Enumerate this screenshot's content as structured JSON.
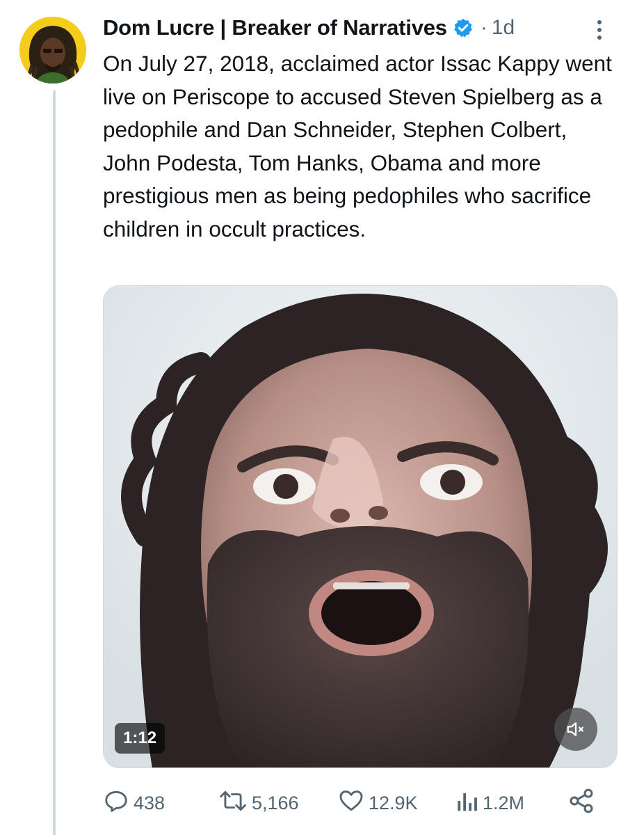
{
  "tweet": {
    "author": {
      "display_name": "Dom Lucre | Breaker of Narratives",
      "verified_icon": "verified-badge-icon",
      "avatar_bg_color": "#f4cc1c"
    },
    "separator": "·",
    "timestamp": "1d",
    "text": "On July 27, 2018, acclaimed actor Issac Kappy went live on Periscope to accused Steven Spielberg as a pedophile and Dan Schneider, Stephen Colbert, John Podesta, Tom Hanks, Obama and more prestigious men as being pedophiles who sacrifice children in occult practices.",
    "media": {
      "type": "video",
      "duration": "1:12",
      "mute_icon": "speaker-muted-icon"
    },
    "actions": {
      "replies": "438",
      "reposts": "5,166",
      "likes": "12.9K",
      "views": "1.2M"
    },
    "icons": {
      "reply": "reply-icon",
      "repost": "repost-icon",
      "like": "heart-icon",
      "views": "views-icon",
      "share": "share-icon",
      "more": "more-vertical-icon"
    }
  },
  "colors": {
    "text": "#0f1419",
    "secondary": "#536471",
    "verified": "#1d9bf0",
    "thread_line": "#cfd9de"
  }
}
